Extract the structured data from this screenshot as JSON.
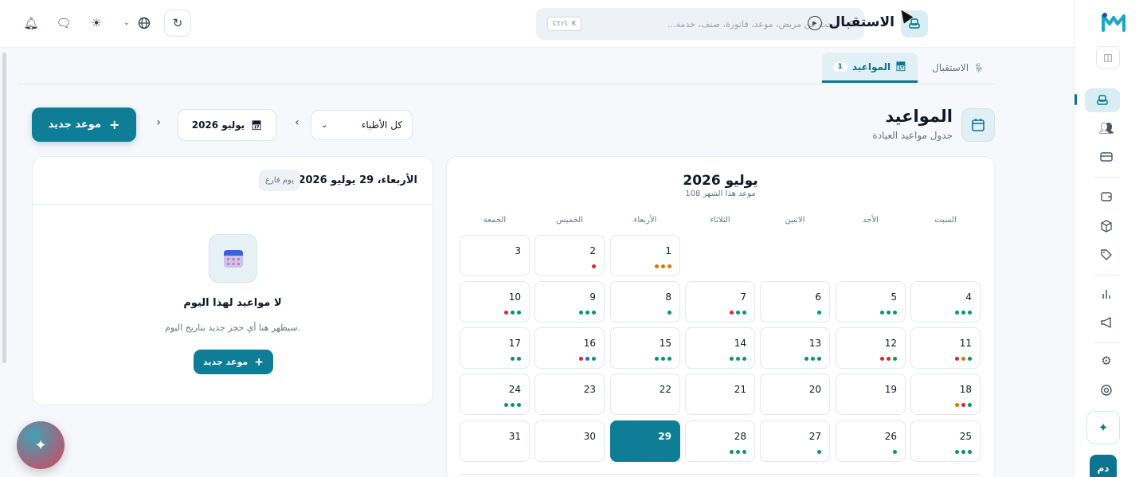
{
  "topbar": {
    "title": "الاستقبال",
    "search_placeholder": "بحث عن مريض، موعد، فاتورة، صنف، خدمة...",
    "shortcut": "Ctrl K"
  },
  "tabs": [
    {
      "label": "الاستقبال",
      "icon": "seat-icon",
      "active": false
    },
    {
      "label": "المواعيد",
      "icon": "calendar-icon",
      "active": true,
      "count": "1"
    }
  ],
  "header": {
    "title": "المواعيد",
    "subtitle": "جدول مواعيد العيادة"
  },
  "toolbar": {
    "doctor_filter": "كل الأطباء",
    "month_label": "يوليو 2026",
    "new_button": "موعد جديد"
  },
  "calendar": {
    "title": "يوليو 2026",
    "count_label": "108 موعد هذا الشهر",
    "weekdays": [
      "السبت",
      "الأحد",
      "الاثنين",
      "الثلاثاء",
      "الأربعاء",
      "الخميس",
      "الجمعة"
    ],
    "today": 29,
    "days": [
      {
        "d": 1,
        "dots": [
          "#d97706",
          "#d97706",
          "#d97706"
        ]
      },
      {
        "d": 2,
        "dots": [
          "#dc2626"
        ]
      },
      {
        "d": 3,
        "dots": []
      },
      {
        "d": 4,
        "dots": [
          "#059669",
          "#059669",
          "#059669"
        ]
      },
      {
        "d": 5,
        "dots": [
          "#059669",
          "#059669",
          "#059669"
        ]
      },
      {
        "d": 6,
        "dots": [
          "#059669"
        ]
      },
      {
        "d": 7,
        "dots": [
          "#059669",
          "#059669",
          "#dc2626"
        ]
      },
      {
        "d": 8,
        "dots": [
          "#059669"
        ]
      },
      {
        "d": 9,
        "dots": [
          "#059669",
          "#059669",
          "#059669"
        ]
      },
      {
        "d": 10,
        "dots": [
          "#059669",
          "#059669",
          "#dc2626"
        ]
      },
      {
        "d": 11,
        "dots": [
          "#059669",
          "#d97706",
          "#dc2626"
        ]
      },
      {
        "d": 12,
        "dots": [
          "#059669",
          "#dc2626",
          "#dc2626"
        ]
      },
      {
        "d": 13,
        "dots": [
          "#059669",
          "#059669",
          "#059669"
        ]
      },
      {
        "d": 14,
        "dots": [
          "#059669",
          "#059669",
          "#059669"
        ]
      },
      {
        "d": 15,
        "dots": [
          "#059669",
          "#059669",
          "#059669"
        ]
      },
      {
        "d": 16,
        "dots": [
          "#059669",
          "#2563eb",
          "#dc2626"
        ]
      },
      {
        "d": 17,
        "dots": [
          "#059669",
          "#059669"
        ]
      },
      {
        "d": 18,
        "dots": [
          "#059669",
          "#dc2626",
          "#d97706"
        ]
      },
      {
        "d": 19,
        "dots": []
      },
      {
        "d": 20,
        "dots": []
      },
      {
        "d": 21,
        "dots": []
      },
      {
        "d": 22,
        "dots": []
      },
      {
        "d": 23,
        "dots": []
      },
      {
        "d": 24,
        "dots": [
          "#059669",
          "#059669",
          "#059669"
        ]
      },
      {
        "d": 25,
        "dots": [
          "#059669",
          "#059669",
          "#059669"
        ]
      },
      {
        "d": 26,
        "dots": [
          "#059669"
        ]
      },
      {
        "d": 27,
        "dots": [
          "#059669"
        ]
      },
      {
        "d": 28,
        "dots": [
          "#059669",
          "#059669",
          "#059669"
        ]
      },
      {
        "d": 29,
        "dots": []
      },
      {
        "d": 30,
        "dots": []
      },
      {
        "d": 31,
        "dots": []
      }
    ]
  },
  "day_panel": {
    "title": "الأربعاء، 29 يوليو 2026",
    "badge": "يوم فارغ",
    "empty_title": "لا مواعيد لهذا اليوم",
    "empty_subtitle": "سيظهر هنا أي حجز جديد بتاريخ اليوم.",
    "new_button": "موعد جديد"
  },
  "rail": {
    "avatar_initials": "دم"
  },
  "colors": {
    "accent": "#0e7d95",
    "accent_light": "#e1f0f4"
  }
}
